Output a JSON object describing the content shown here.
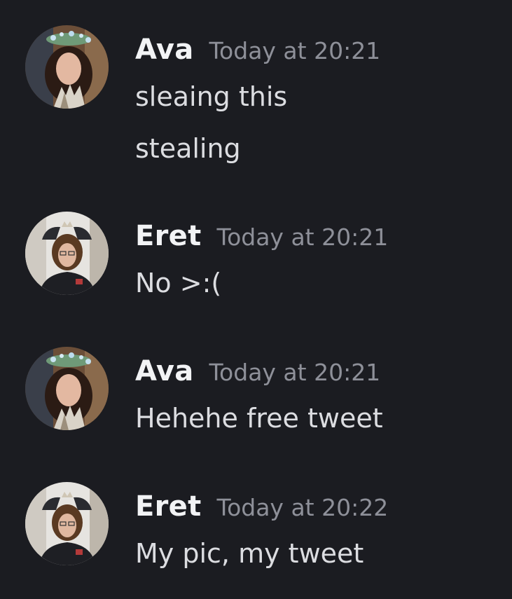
{
  "messages": [
    {
      "author": "Ava",
      "timestamp": "Today at 20:21",
      "lines": [
        "sleaing this",
        "stealing"
      ]
    },
    {
      "author": "Eret",
      "timestamp": "Today at 20:21",
      "lines": [
        "No >:("
      ]
    },
    {
      "author": "Ava",
      "timestamp": "Today at 20:21",
      "lines": [
        "Hehehe free tweet"
      ]
    },
    {
      "author": "Eret",
      "timestamp": "Today at 20:22",
      "lines": [
        "My pic, my tweet"
      ]
    }
  ],
  "colors": {
    "background": "#1b1c21",
    "username": "#f2f3f5",
    "timestamp": "#8e9099",
    "message_text": "#dcdde1"
  }
}
